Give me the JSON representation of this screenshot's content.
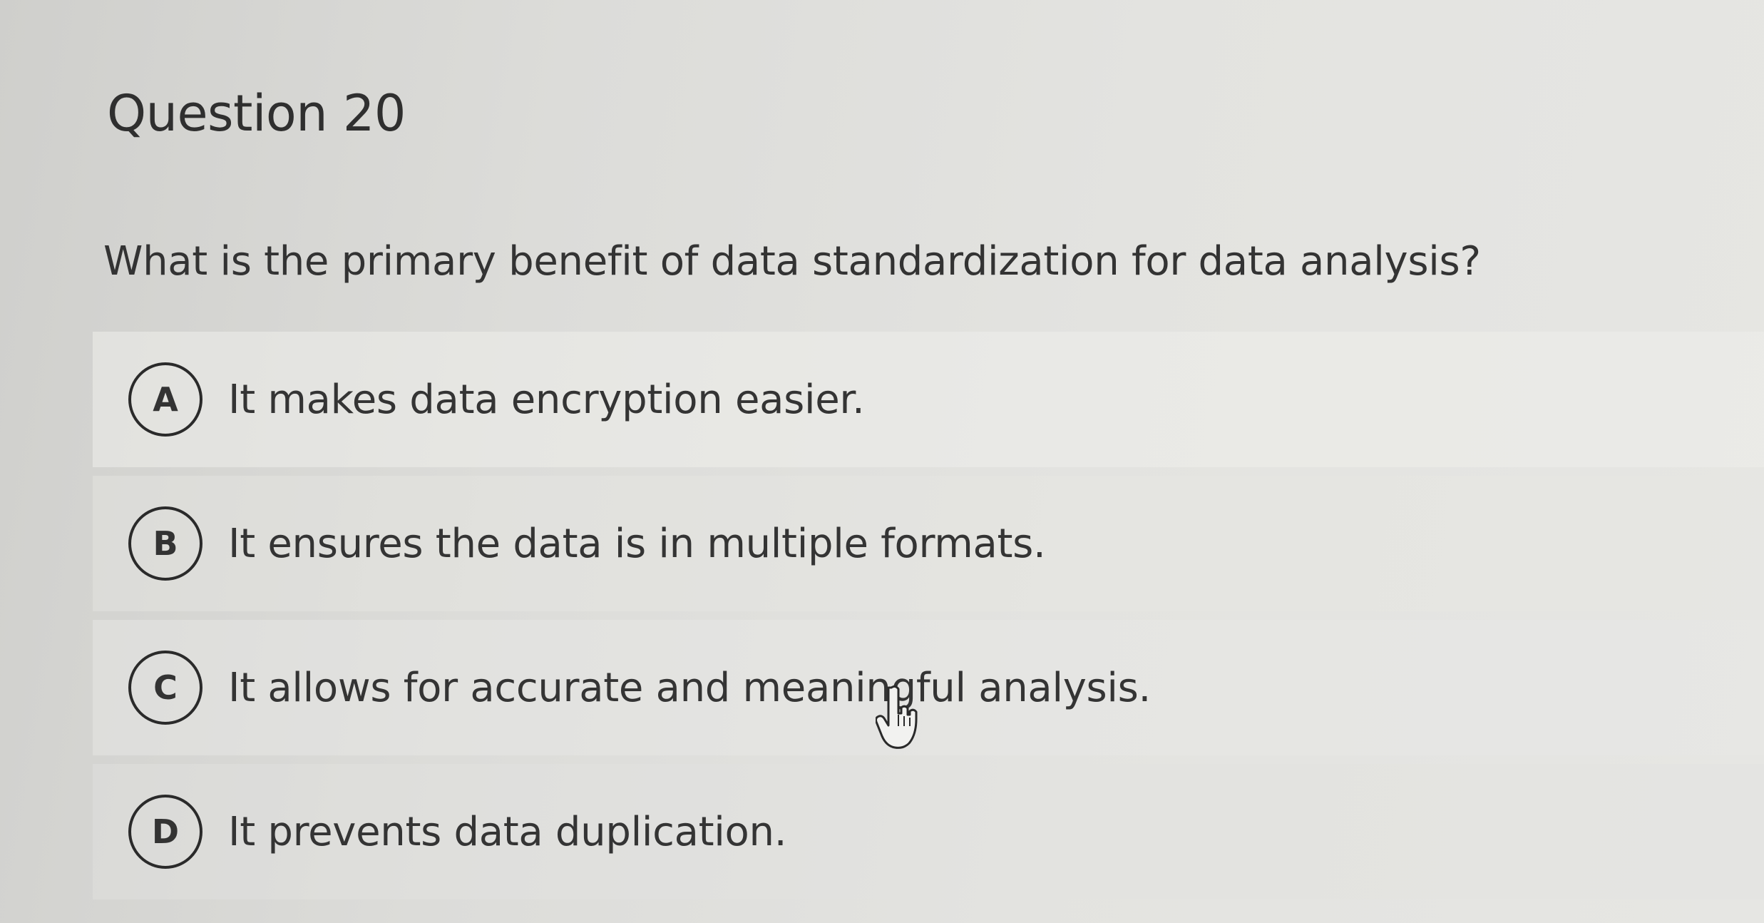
{
  "question": {
    "title": "Question 20",
    "text": "What is the primary benefit of data standardization for data analysis?"
  },
  "options": [
    {
      "letter": "A",
      "text": "It makes data encryption easier."
    },
    {
      "letter": "B",
      "text": "It ensures the data is in multiple formats."
    },
    {
      "letter": "C",
      "text": "It allows for accurate and meaningful analysis."
    },
    {
      "letter": "D",
      "text": "It prevents data duplication."
    }
  ],
  "cursor": {
    "icon": "hand-pointer-icon"
  }
}
